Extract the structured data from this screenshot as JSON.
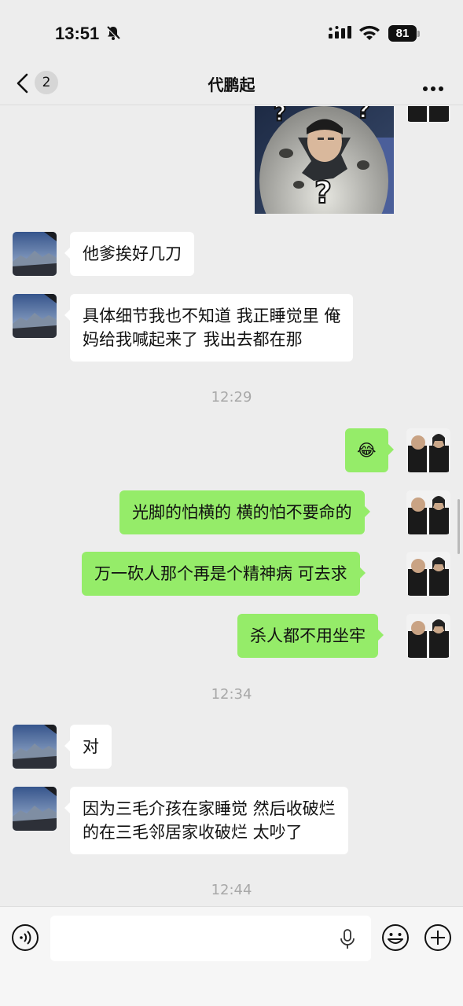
{
  "status_bar": {
    "time": "13:51",
    "battery": "81"
  },
  "header": {
    "unread_count": "2",
    "title": "代鹏起"
  },
  "messages": [
    {
      "text": "他爹挨好几刀"
    },
    {
      "line1": "具体细节我也不知道 我正睡觉里 俺",
      "line2": "妈给我喊起来了 我出去都在那"
    },
    {
      "time": "12:29"
    },
    {
      "emoji": "😂"
    },
    {
      "text": "光脚的怕横的 横的怕不要命的"
    },
    {
      "text": "万一砍人那个再是个精神病 可去求"
    },
    {
      "text": "杀人都不用坐牢"
    },
    {
      "time": "12:34"
    },
    {
      "text": "对"
    },
    {
      "line1": "因为三毛介孩在家睡觉 然后收破烂",
      "line2": "的在三毛邻居家收破烂 太吵了"
    },
    {
      "time": "12:44"
    }
  ],
  "colors": {
    "outgoing_bubble": "#95ec69",
    "incoming_bubble": "#ffffff",
    "background": "#ededed"
  }
}
